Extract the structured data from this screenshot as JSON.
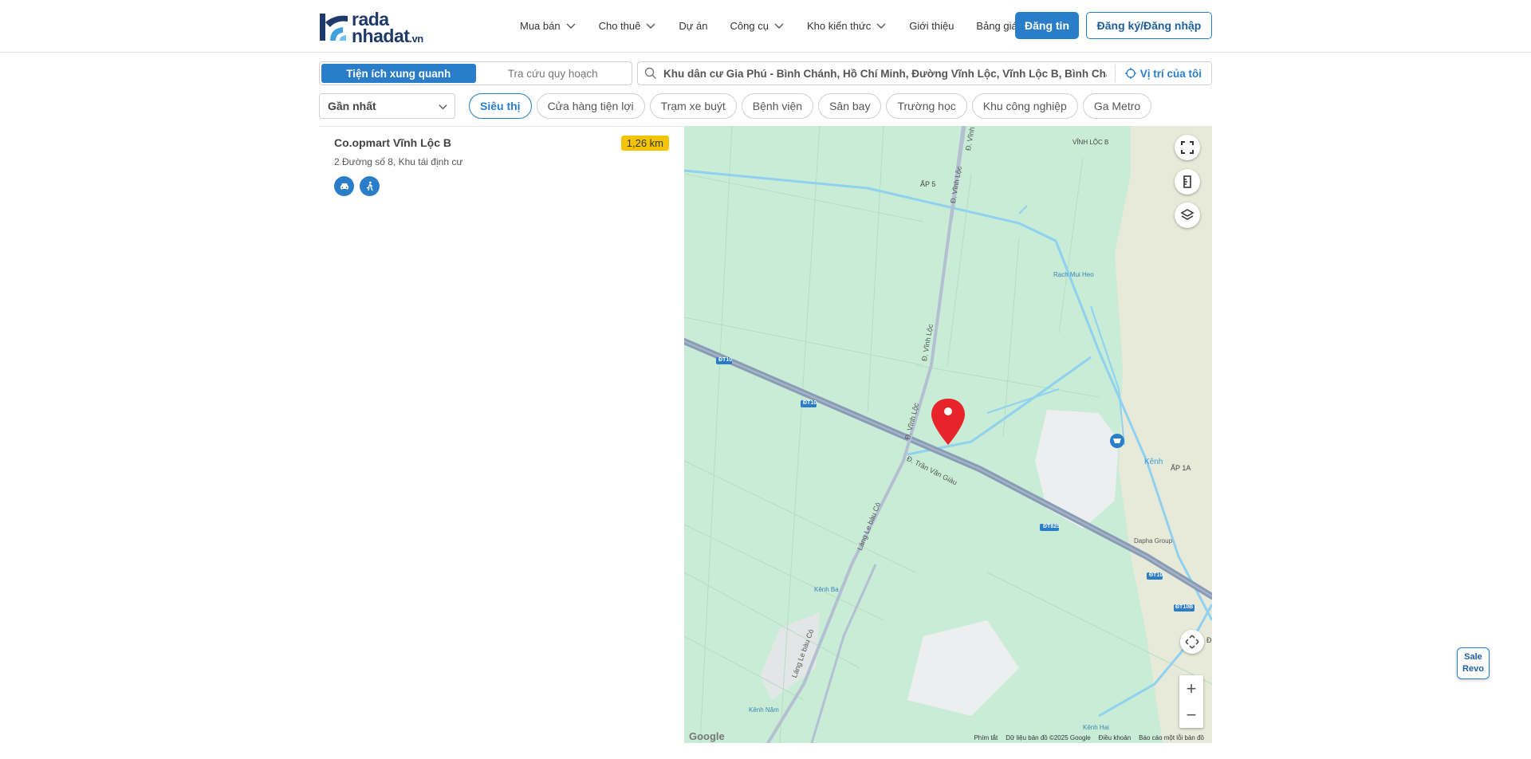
{
  "brand": {
    "line1": "rada",
    "line2": "nhadat",
    "tld": ".vn"
  },
  "nav": [
    {
      "label": "Mua bán",
      "dropdown": true
    },
    {
      "label": "Cho thuê",
      "dropdown": true
    },
    {
      "label": "Dự án",
      "dropdown": false
    },
    {
      "label": "Công cụ",
      "dropdown": true
    },
    {
      "label": "Kho kiến thức",
      "dropdown": true
    },
    {
      "label": "Giới thiệu",
      "dropdown": false
    },
    {
      "label": "Bảng giá",
      "dropdown": false
    }
  ],
  "header": {
    "post_label": "Đăng tin",
    "login_label": "Đăng ký/Đăng nhập"
  },
  "tabs": {
    "active": "Tiện ích xung quanh",
    "inactive": "Tra cứu quy hoạch"
  },
  "search": {
    "value": "Khu dân cư Gia Phú - Bình Chánh, Hồ Chí Minh, Đường Vĩnh Lộc, Vĩnh Lộc B, Bình Chánh, Hồ Chí Minh",
    "my_location": "Vị trí của tôi"
  },
  "sort": {
    "selected": "Gần nhất"
  },
  "chips": [
    "Siêu thị",
    "Cửa hàng tiện lợi",
    "Trạm xe buýt",
    "Bệnh viện",
    "Sân bay",
    "Trường học",
    "Khu công nghiệp",
    "Ga Metro"
  ],
  "results": [
    {
      "name": "Co.opmart Vĩnh Lộc B",
      "address": "2 Đường số 8, Khu tái định cư",
      "distance": "1,26 km"
    }
  ],
  "map": {
    "labels": {
      "ap5": "ẤP 5",
      "vinhlocb": "VĨNH LỘC B",
      "vinhloc1": "Đ. Vĩnh Lộc",
      "vinhloc2": "Đ. Vĩnh Lộc",
      "vinhloc3": "Đ. Vĩnh Lộc",
      "vinhloc_top": "Đ. Vĩnh",
      "rach": "Rạch Mui Heo",
      "dt10a": "ĐT10",
      "dt10b": "ĐT10",
      "dt10c": "ĐT10",
      "dt10d": "ĐT10B",
      "dt825": "ĐT825",
      "tranvangiau": "Đ. Trần Văn Giàu",
      "langle1": "Láng Le bàu Cò",
      "langle2": "Láng Le bàu Cò",
      "kenh": "Kênh",
      "ap1a": "ẤP 1A",
      "dapha": "Dapha Group",
      "kenhba": "Kênh Ba",
      "kenhnam": "Kênh Năm",
      "kenhhai": "Kênh Hai",
      "d_right": "Đ"
    },
    "footer": [
      "Phím tắt",
      "Dữ liệu bản đồ ©2025 Google",
      "Điều khoản",
      "Báo cáo một lỗi bản đồ"
    ],
    "google": "Google",
    "colors": {
      "land": "#c8ecd6",
      "road": "#8a9bb5",
      "water": "#8fd1ef",
      "pin": "#e8242b",
      "accent": "#2a7dc8"
    }
  },
  "sale_widget": {
    "line1": "Sale",
    "line2": "Revo"
  }
}
